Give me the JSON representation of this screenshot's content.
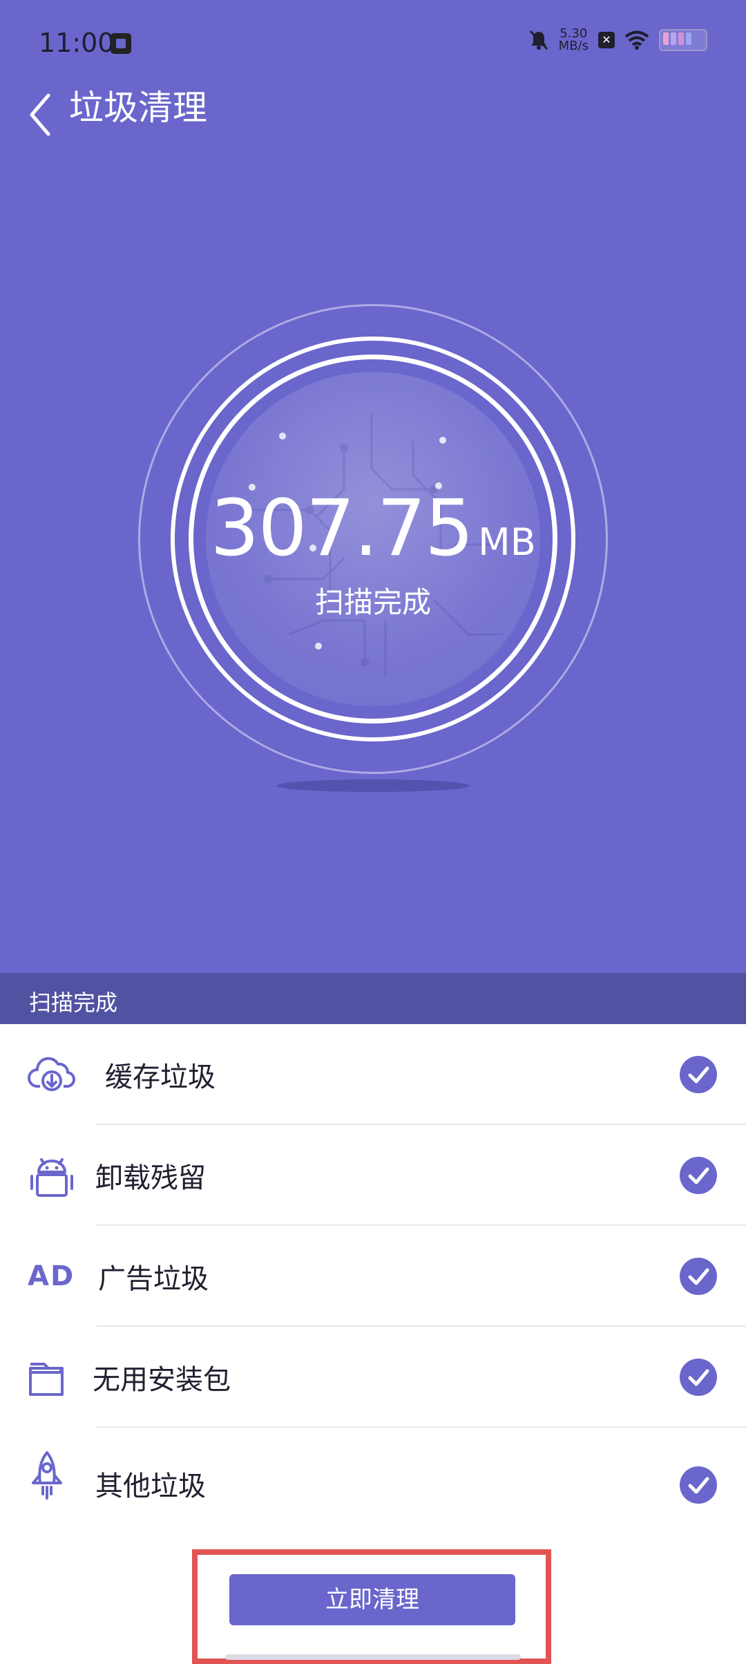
{
  "status_bar": {
    "time": "11:00",
    "speed_value": "5.30",
    "speed_unit": "MB/s",
    "box_label": "✕"
  },
  "header": {
    "title": "垃圾清理"
  },
  "scan": {
    "size_number": "307.75",
    "size_unit": "MB",
    "status": "扫描完成"
  },
  "section": {
    "label": "扫描完成"
  },
  "items": [
    {
      "label": "缓存垃圾",
      "icon": "cloud-download-icon",
      "checked": true
    },
    {
      "label": "卸载残留",
      "icon": "android-icon",
      "checked": true
    },
    {
      "label": "广告垃圾",
      "icon": "ad-icon",
      "icon_text": "AD",
      "checked": true
    },
    {
      "label": "无用安装包",
      "icon": "folder-icon",
      "checked": true
    },
    {
      "label": "其他垃圾",
      "icon": "rocket-icon",
      "checked": true
    }
  ],
  "actions": {
    "clean_now": "立即清理"
  },
  "colors": {
    "primary": "#6A66CC",
    "section_bg": "#5152A2",
    "highlight": "#E25454"
  }
}
